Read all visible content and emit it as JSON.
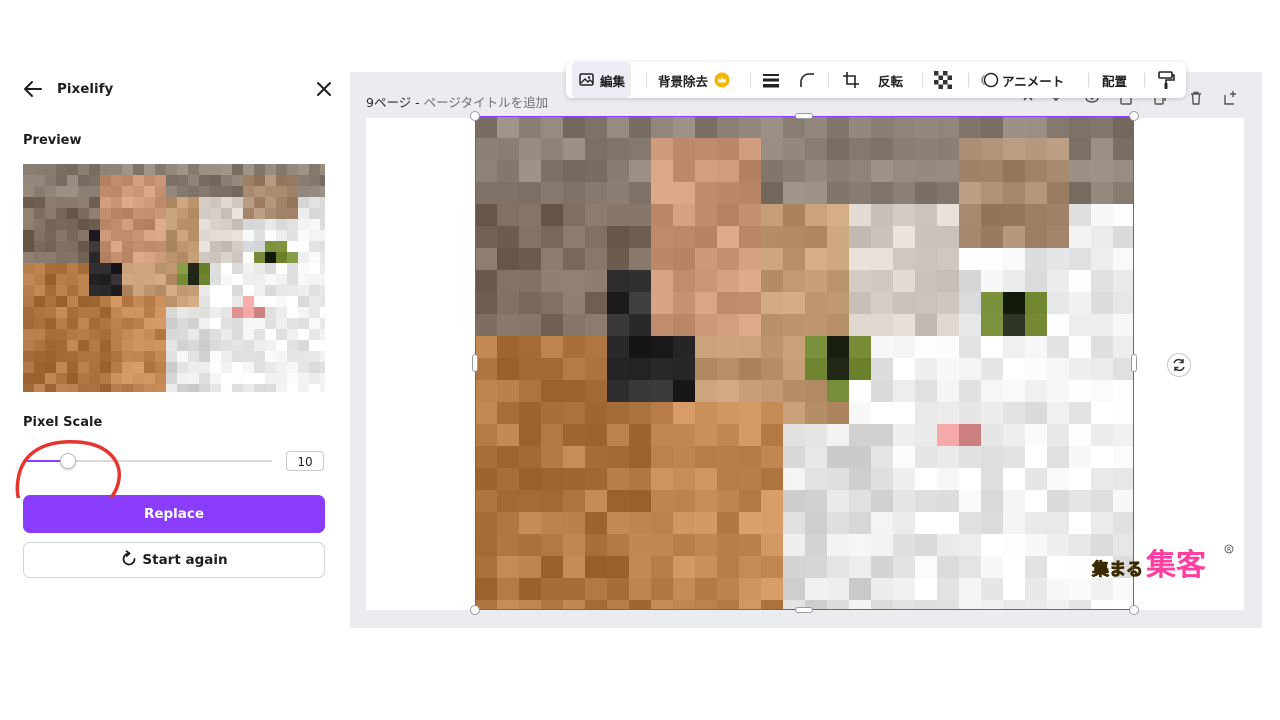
{
  "panel": {
    "title": "Pixelify",
    "preview_label": "Preview",
    "pixel_scale_label": "Pixel Scale",
    "pixel_scale_value": "10",
    "pixel_scale_fraction": 0.18,
    "replace_label": "Replace",
    "start_again_label": "Start again"
  },
  "editor": {
    "page_number": "9ページ -",
    "page_title_placeholder": "ページタイトルを追加"
  },
  "toolbar": {
    "edit_label": "編集",
    "remove_bg_label": "背景除去",
    "flip_label": "反転",
    "animate_label": "アニメート",
    "position_label": "配置"
  },
  "watermark": {
    "text": "集まる集客"
  },
  "colors": {
    "accent": "#8b3dff",
    "annotation": "#e4352f",
    "crown": "#f5b400"
  },
  "icons": {
    "back": "arrow-left-icon",
    "close": "close-icon",
    "refresh": "refresh-icon",
    "edit": "image-edit-icon",
    "crown": "crown-icon",
    "lines": "line-weight-icon",
    "corner": "corner-radius-icon",
    "crop": "crop-icon",
    "transparency": "transparency-icon",
    "animate": "animate-icon",
    "paint": "copy-style-icon"
  }
}
